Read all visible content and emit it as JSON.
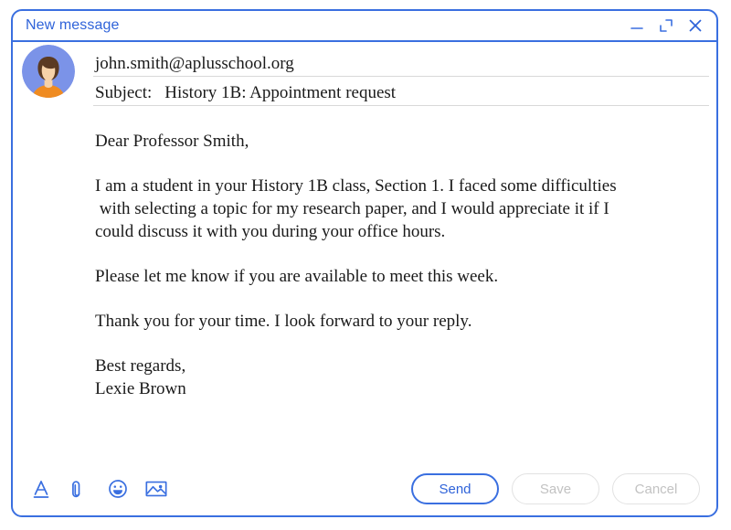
{
  "window": {
    "title": "New message",
    "accent_color": "#3a6fe0",
    "title_color": "#2f63d9",
    "controls": [
      {
        "name": "minimize",
        "label": "minimize-icon"
      },
      {
        "name": "expand",
        "label": "expand-icon"
      },
      {
        "name": "close",
        "label": "close-icon"
      }
    ]
  },
  "compose": {
    "avatar": {
      "icon": "user-avatar-icon",
      "background_color": "#7b93e8",
      "hair_color": "#5b3a22",
      "skin_color": "#f6d2a9",
      "shirt_color": "#ef8b21"
    },
    "recipient": {
      "value": "john.smith@aplusschool.org",
      "placeholder": "Recipient"
    },
    "subject": {
      "label": "Subject:",
      "value": "History 1B: Appointment request",
      "placeholder": "Subject"
    },
    "body_paragraphs": [
      "Dear Professor Smith,",
      "I am a student in your History 1B class, Section 1. I faced some difficulties\n with selecting a topic for my research paper, and I would appreciate it if I\ncould discuss it with you during your office hours.",
      "Please let me know if you are available to meet this week.",
      "Thank you for your time. I look forward to your reply.",
      "Best regards,\nLexie Brown"
    ]
  },
  "toolbar": {
    "icons": [
      {
        "name": "text-format-icon",
        "label": "Formatting options"
      },
      {
        "name": "attachment-icon",
        "label": "Attach files"
      },
      {
        "name": "emoji-icon",
        "label": "Insert emoji"
      },
      {
        "name": "image-icon",
        "label": "Insert photo"
      }
    ]
  },
  "actions": {
    "send_label": "Send",
    "save_label": "Save",
    "cancel_label": "Cancel",
    "send_color": "#2f63d9",
    "disabled_color": "#c2c2c2"
  }
}
